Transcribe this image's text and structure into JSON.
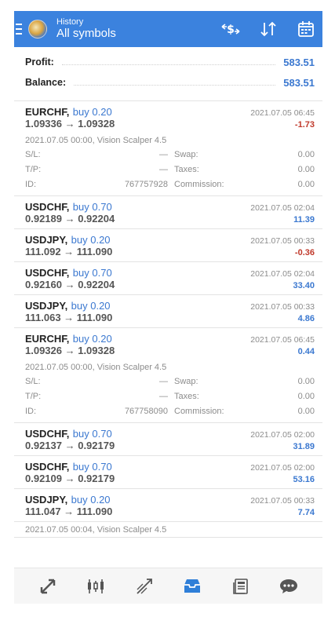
{
  "header": {
    "subtitle": "History",
    "title": "All symbols",
    "icons": [
      "dollar-swap-icon",
      "sort-icon",
      "calendar-icon"
    ]
  },
  "summary": {
    "profit_label": "Profit:",
    "profit_value": "583.51",
    "balance_label": "Balance:",
    "balance_value": "583.51"
  },
  "deals": [
    {
      "symbol": "EURCHF,",
      "side": "buy 0.20",
      "prices": "1.09336 → 1.09328",
      "datetime": "2021.07.05 06:45",
      "profit": "-1.73",
      "negative": true,
      "expanded": true,
      "comment": "2021.07.05 00:00, Vision Scalper 4.5",
      "sl_label": "S/L:",
      "sl": "—",
      "swap_label": "Swap:",
      "swap": "0.00",
      "tp_label": "T/P:",
      "tp": "—",
      "taxes_label": "Taxes:",
      "taxes": "0.00",
      "id_label": "ID:",
      "id": "767757928",
      "commission_label": "Commission:",
      "commission": "0.00"
    },
    {
      "symbol": "USDCHF,",
      "side": "buy 0.70",
      "prices": "0.92189 → 0.92204",
      "datetime": "2021.07.05 02:04",
      "profit": "11.39"
    },
    {
      "symbol": "USDJPY,",
      "side": "buy 0.20",
      "prices": "111.092 → 111.090",
      "datetime": "2021.07.05 00:33",
      "profit": "-0.36"
    },
    {
      "symbol": "USDCHF,",
      "side": "buy 0.70",
      "prices": "0.92160 → 0.92204",
      "datetime": "2021.07.05 02:04",
      "profit": "33.40"
    },
    {
      "symbol": "USDJPY,",
      "side": "buy 0.20",
      "prices": "111.063 → 111.090",
      "datetime": "2021.07.05 00:33",
      "profit": "4.86"
    },
    {
      "symbol": "EURCHF,",
      "side": "buy 0.20",
      "prices": "1.09326 → 1.09328",
      "datetime": "2021.07.05 06:45",
      "profit": "0.44",
      "comment": "2021.07.05 00:00, Vision Scalper 4.5",
      "sl_label": "S/L:",
      "sl": "—",
      "swap_label": "Swap:",
      "swap": "0.00",
      "tp_label": "T/P:",
      "tp": "—",
      "taxes_label": "Taxes:",
      "taxes": "0.00",
      "id_label": "ID:",
      "id": "767758090",
      "commission_label": "Commission:",
      "commission": "0.00"
    },
    {
      "symbol": "USDCHF,",
      "side": "buy 0.70",
      "prices": "0.92137 → 0.92179",
      "datetime": "2021.07.05 02:00",
      "profit": "31.89"
    },
    {
      "symbol": "USDCHF,",
      "side": "buy 0.70",
      "prices": "0.92109 → 0.92179",
      "datetime": "2021.07.05 02:00",
      "profit": "53.16"
    },
    {
      "symbol": "USDJPY,",
      "side": "buy 0.20",
      "prices": "111.047 → 111.090",
      "datetime": "2021.07.05 00:33",
      "profit": "7.74"
    }
  ],
  "partial_comment": "2021.07.05 00:04, Vision Scalper 4.5",
  "bottom_nav": [
    "quotes-icon",
    "chart-icon",
    "trade-icon",
    "history-icon",
    "news-icon",
    "chat-icon"
  ],
  "colors": {
    "accent": "#3b82de",
    "positive": "#3b78d0",
    "negative": "#c0392b"
  }
}
